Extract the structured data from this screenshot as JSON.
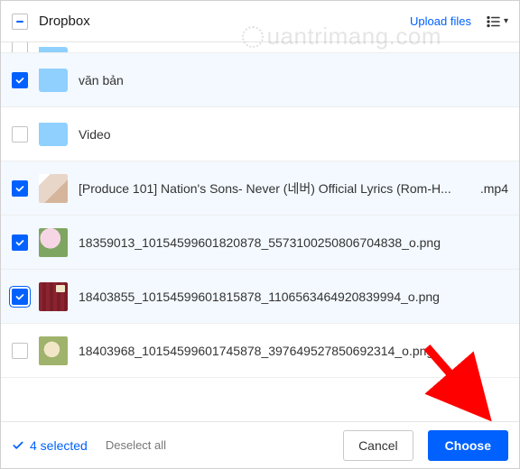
{
  "header": {
    "title": "Dropbox",
    "upload_label": "Upload files"
  },
  "rows": [
    {
      "name": "",
      "checked": false,
      "type": "folder"
    },
    {
      "name": "văn bản",
      "checked": true,
      "type": "folder"
    },
    {
      "name": "Video",
      "checked": false,
      "type": "folder"
    },
    {
      "name": "[Produce 101] Nation's Sons- Never (네버) Official Lyrics (Rom-H...",
      "ext": ".mp4",
      "checked": true,
      "type": "img1"
    },
    {
      "name": "18359013_10154599601820878_5573100250806704838_o.png",
      "checked": true,
      "type": "img2"
    },
    {
      "name": "18403855_10154599601815878_1106563464920839994_o.png",
      "checked": true,
      "type": "img3",
      "outlined": true
    },
    {
      "name": "18403968_10154599601745878_397649527850692314_o.png",
      "checked": false,
      "type": "img4"
    }
  ],
  "footer": {
    "selected_label": "4 selected",
    "deselect_label": "Deselect all",
    "cancel_label": "Cancel",
    "choose_label": "Choose"
  },
  "watermark": "uantrimang.com"
}
